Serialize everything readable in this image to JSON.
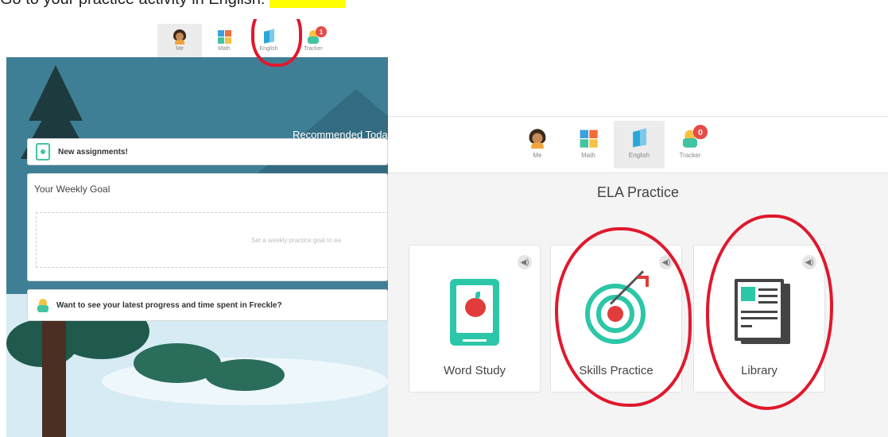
{
  "instruction": {
    "text": "Go to your practice activity in English:",
    "highlight_color": "#ffff00"
  },
  "accent_circle_color": "#e0182d",
  "left_panel": {
    "nav": [
      {
        "label": "Me",
        "icon": "avatar-icon",
        "active": true
      },
      {
        "label": "Math",
        "icon": "math-grid-icon"
      },
      {
        "label": "English",
        "icon": "book-icon",
        "circled": true
      },
      {
        "label": "Tracker",
        "icon": "tracker-icon",
        "badge": "1"
      }
    ],
    "recommended_title": "Recommended Toda",
    "assignment_text": "New assignments!",
    "weekly_goal_title": "Your Weekly Goal",
    "weekly_goal_hint": "Set a weekly practice goal to ea",
    "progress_prompt": "Want to see your latest progress and time spent in Freckle?"
  },
  "right_panel": {
    "nav": [
      {
        "label": "Me",
        "icon": "avatar-icon"
      },
      {
        "label": "Math",
        "icon": "math-grid-icon"
      },
      {
        "label": "English",
        "icon": "book-icon",
        "active": true
      },
      {
        "label": "Tracker",
        "icon": "tracker-icon",
        "badge": "0"
      }
    ],
    "title": "ELA Practice",
    "tiles": [
      {
        "label": "Word Study",
        "icon": "apple-book-icon",
        "circled": false
      },
      {
        "label": "Skills Practice",
        "icon": "target-icon",
        "circled": true
      },
      {
        "label": "Library",
        "icon": "newspaper-icon",
        "circled": true
      }
    ],
    "speaker_glyph": "◀)"
  }
}
